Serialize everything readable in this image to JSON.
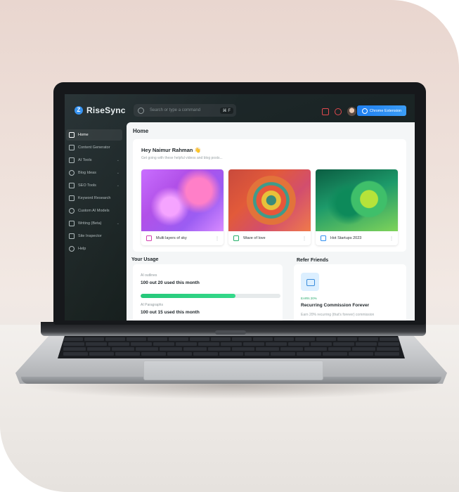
{
  "app": {
    "logo_mark": "Z",
    "name": "RiseSync"
  },
  "search": {
    "placeholder": "Search or type a command",
    "shortcut": "⌘ F"
  },
  "header": {
    "chrome_button": "Chrome Extension"
  },
  "sidebar": {
    "items": [
      {
        "label": "Home",
        "icon": "home-icon",
        "chevron": false,
        "active": true
      },
      {
        "label": "Content Generator",
        "icon": "edit-icon",
        "chevron": false
      },
      {
        "label": "AI Tools",
        "icon": "sparkle-icon",
        "chevron": true
      },
      {
        "label": "Blog Ideas",
        "icon": "lightbulb-icon",
        "chevron": true
      },
      {
        "label": "SEO Tools",
        "icon": "seo-icon",
        "chevron": true
      },
      {
        "label": "Keyword Research",
        "icon": "key-icon",
        "chevron": false
      },
      {
        "label": "Custom AI Models",
        "icon": "model-icon",
        "chevron": false
      },
      {
        "label": "Writing (Beta)",
        "icon": "pen-icon",
        "chevron": true
      },
      {
        "label": "Site Inspector",
        "icon": "inspector-icon",
        "chevron": false
      },
      {
        "label": "Help",
        "icon": "help-icon",
        "chevron": false
      }
    ]
  },
  "main": {
    "title": "Home",
    "greeting": "Hey Naimur Rahman 👋",
    "greeting_sub": "Get going with these helpful videos and blog posts...",
    "cards": [
      {
        "label": "Multi layers of sky",
        "icon_color": "#d23fae"
      },
      {
        "label": "Wave of love",
        "icon_color": "#26b06a"
      },
      {
        "label": "Hot Startups 2023",
        "icon_color": "#2f8ff0"
      }
    ],
    "more_glyph": "⋮"
  },
  "usage": {
    "title": "Your Usage",
    "rows": [
      {
        "label": "AI outlines",
        "value": "100 out 20 used this month",
        "progress_pct": 68
      },
      {
        "label": "AI Paragraphs",
        "value": "100 out 15 used this month"
      }
    ]
  },
  "refer": {
    "title": "Refer Friends",
    "tag": "EARN 20%",
    "heading": "Recurring Commission Forever",
    "body": "Earn 20% recurring (that's forever) commission"
  },
  "colors": {
    "accent": "#2f8ff0",
    "progress": "#26c87a"
  }
}
